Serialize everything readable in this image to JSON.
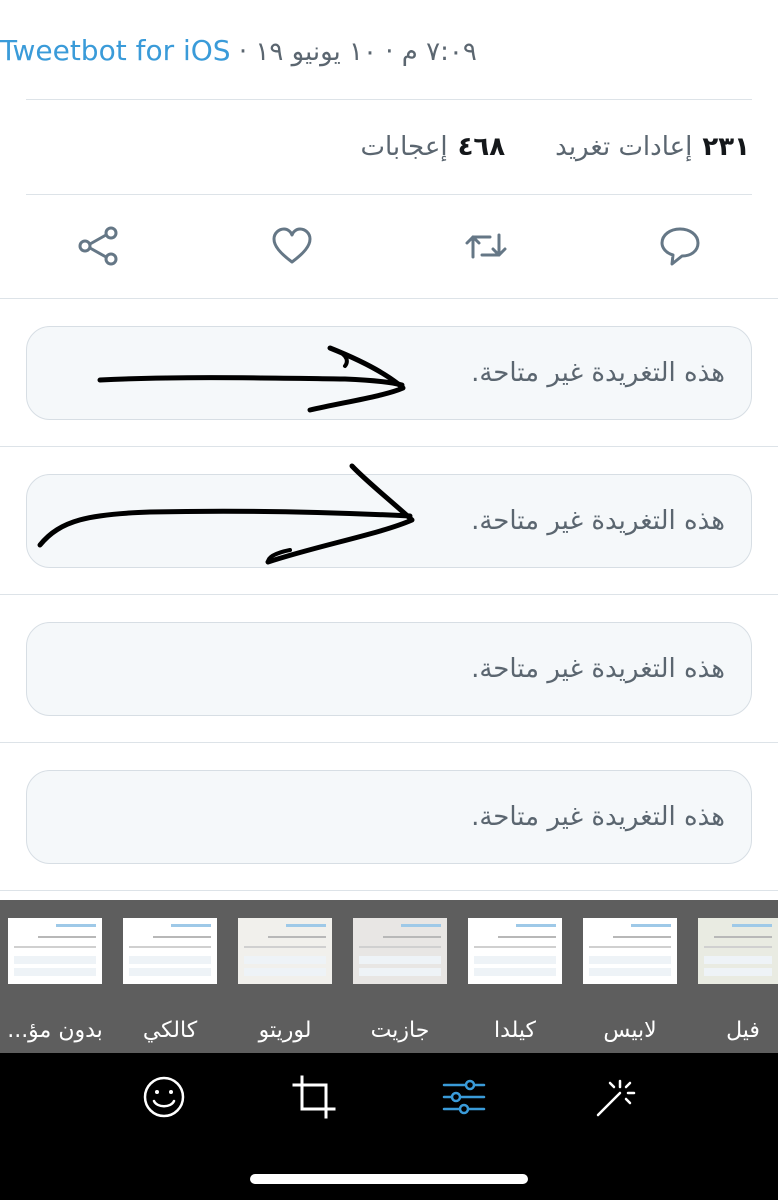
{
  "tweet": {
    "timestamp": "٧:٠٩ م · ١٠ يونيو ١٩ ·",
    "client": "Tweetbot for iOS"
  },
  "stats": {
    "retweets_count": "٢٣١",
    "retweets_label": "إعادات تغريد",
    "likes_count": "٤٦٨",
    "likes_label": "إعجابات"
  },
  "actions": [
    {
      "name": "reply",
      "icon": "reply-icon"
    },
    {
      "name": "retweet",
      "icon": "retweet-icon"
    },
    {
      "name": "like",
      "icon": "heart-icon"
    },
    {
      "name": "share",
      "icon": "share-icon"
    }
  ],
  "unavailable_tweets": [
    {
      "text": "هذه التغريدة غير متاحة."
    },
    {
      "text": "هذه التغريدة غير متاحة."
    },
    {
      "text": "هذه التغريدة غير متاحة."
    },
    {
      "text": "هذه التغريدة غير متاحة."
    }
  ],
  "filters": [
    {
      "label": "فيل"
    },
    {
      "label": "لابيس"
    },
    {
      "label": "كيلدا"
    },
    {
      "label": "جازيت"
    },
    {
      "label": "لوريتو"
    },
    {
      "label": "كالكي"
    },
    {
      "label": "بدون مؤ..."
    }
  ],
  "editor_tools": [
    {
      "name": "magic",
      "icon": "magic-wand-icon"
    },
    {
      "name": "adjust",
      "icon": "adjust-sliders-icon",
      "active": true
    },
    {
      "name": "crop",
      "icon": "crop-icon"
    },
    {
      "name": "sticker",
      "icon": "smiley-icon"
    }
  ],
  "colors": {
    "link": "#3a9bd9",
    "active_tool": "#3a9bd9",
    "icon_grey": "#657786",
    "card_bg": "#f5f8fa",
    "annotation_ink": "#000000"
  }
}
